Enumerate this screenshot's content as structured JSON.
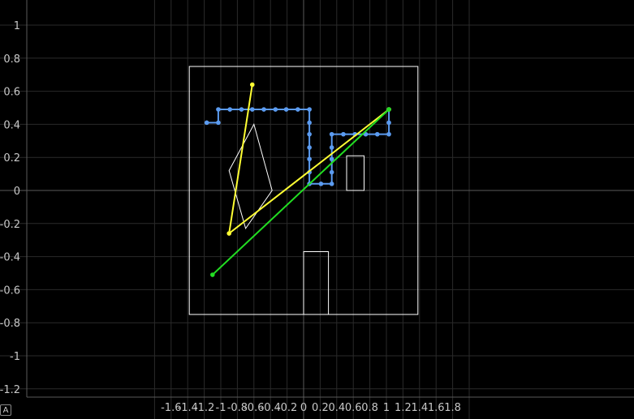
{
  "chart_data": {
    "type": "scatter",
    "title": "",
    "xlabel": "",
    "ylabel": "",
    "xlim": [
      -1.8,
      2.0
    ],
    "ylim": [
      -1.3,
      1.15
    ],
    "grid": true,
    "x_ticks": [
      -1.6,
      -1.4,
      -1.2,
      -1,
      -0.8,
      -0.6,
      -0.4,
      -0.2,
      0,
      0.2,
      0.4,
      0.6,
      0.8,
      1,
      1.2,
      1.4,
      1.6,
      1.8
    ],
    "x_tick_labels": [
      "-1.6",
      "-1.4",
      "-1.2",
      "-1",
      "-0.8",
      "-0.6",
      "-0.4",
      "-0.2",
      "0",
      "0.2",
      "0.4",
      "0.6",
      "0.8",
      "1",
      "1.2",
      "1.4",
      "1.6",
      "1.8"
    ],
    "y_ticks": [
      1,
      0.8,
      0.6,
      0.4,
      0.2,
      0,
      -0.2,
      -0.4,
      -0.6,
      -0.8,
      -1,
      -1.2
    ],
    "y_tick_labels": [
      "1",
      "0.8",
      "0.6",
      "0.4",
      "0.2",
      "0",
      "-0.2",
      "-0.4",
      "-0.6",
      "-0.8",
      "-1",
      "-1.2"
    ],
    "shapes": [
      {
        "name": "boundary",
        "color": "#ffffff",
        "points": [
          [
            -1.38,
            0.75
          ],
          [
            1.38,
            0.75
          ],
          [
            1.38,
            -0.75
          ],
          [
            -1.38,
            -0.75
          ]
        ]
      },
      {
        "name": "obstacle-rotated",
        "color": "#ffffff",
        "points": [
          [
            -0.9,
            0.12
          ],
          [
            -0.6,
            0.4
          ],
          [
            -0.38,
            0.0
          ],
          [
            -0.7,
            -0.23
          ]
        ]
      },
      {
        "name": "obstacle-small",
        "color": "#ffffff",
        "points": [
          [
            0.52,
            0.21
          ],
          [
            0.73,
            0.21
          ],
          [
            0.73,
            0.0
          ],
          [
            0.52,
            0.0
          ]
        ]
      },
      {
        "name": "obstacle-bottom",
        "color": "#ffffff",
        "points": [
          [
            0.0,
            -0.37
          ],
          [
            0.3,
            -0.37
          ],
          [
            0.3,
            -0.75
          ],
          [
            0.0,
            -0.75
          ]
        ]
      }
    ],
    "series": [
      {
        "color": "#5b9bf0",
        "points": [
          [
            -1.17,
            0.41
          ],
          [
            -1.03,
            0.41
          ],
          [
            -1.03,
            0.49
          ],
          [
            -0.89,
            0.49
          ],
          [
            -0.75,
            0.49
          ],
          [
            -0.62,
            0.49
          ],
          [
            -0.48,
            0.49
          ],
          [
            -0.34,
            0.49
          ],
          [
            -0.21,
            0.49
          ],
          [
            -0.07,
            0.49
          ],
          [
            0.07,
            0.49
          ],
          [
            0.07,
            0.41
          ],
          [
            0.07,
            0.34
          ],
          [
            0.07,
            0.26
          ],
          [
            0.07,
            0.19
          ],
          [
            0.07,
            0.11
          ],
          [
            0.07,
            0.04
          ],
          [
            0.21,
            0.04
          ],
          [
            0.34,
            0.04
          ],
          [
            0.34,
            0.11
          ],
          [
            0.34,
            0.19
          ],
          [
            0.34,
            0.26
          ],
          [
            0.34,
            0.34
          ],
          [
            0.48,
            0.34
          ],
          [
            0.62,
            0.34
          ],
          [
            0.75,
            0.34
          ],
          [
            0.89,
            0.34
          ],
          [
            1.03,
            0.34
          ],
          [
            1.03,
            0.41
          ],
          [
            1.03,
            0.49
          ]
        ],
        "markers": true
      },
      {
        "color": "#ffff33",
        "points": [
          [
            -0.62,
            0.64
          ],
          [
            -0.9,
            -0.26
          ],
          [
            1.03,
            0.49
          ]
        ],
        "markers": true
      },
      {
        "color": "#22dd22",
        "points": [
          [
            -1.1,
            -0.51
          ],
          [
            1.03,
            0.49
          ]
        ],
        "markers": true
      }
    ]
  },
  "corner_badge": "A"
}
